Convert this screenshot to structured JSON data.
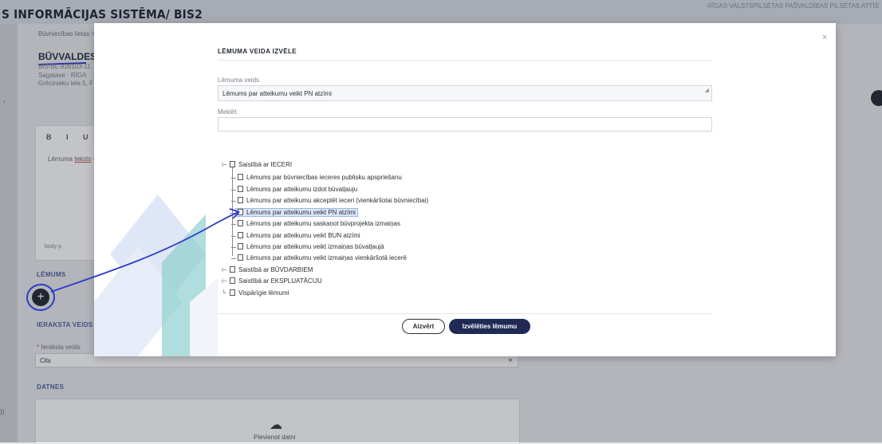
{
  "app": {
    "title": "S INFORMĀCIJAS SISTĒMA/ BIS2",
    "top_right": "RĪGAS VALSTSPILSĒTAS PAŠVALDĪBAS PILSĒTAS ATTĪS"
  },
  "background": {
    "breadcrumb": "Būvniecības lietas > B",
    "doc_title": "BŪVVALDES I",
    "doc_id": "BIS-BL-828103-11",
    "doc_status": "Sagatave · RĪGA",
    "doc_address": "Grēcinieku iela 5, F",
    "editor_toolbar": "B I U ×,",
    "editor_text_prefix": "Lēmuma ",
    "editor_text_underlined": "teksts",
    "editor_text_suffix": " -",
    "editor_footer": "body  p",
    "section_lemums": "LĒMUMS",
    "section_ieraksta_veids": "IERAKSTA VEIDS",
    "field_label": "Ieraksta veids",
    "field_value": "Cits",
    "section_datnes": "DATNES",
    "upload_label": "Pievienot datni",
    "edge_text": "))"
  },
  "modal": {
    "title": "LĒMUMA VEIDA IZVĒLE",
    "decision_type_label": "Lēmuma veids",
    "decision_type_value": "Lēmums par atteikumu veikt PN atzīmi",
    "search_label": "Meklēt",
    "search_value": "",
    "tree": [
      {
        "label": "Saistībā ar IECERI",
        "expanded": true,
        "children": [
          {
            "label": "Lēmums par būvniecības ieceres publisku apspriešanu"
          },
          {
            "label": "Lēmums par atteikumu izdot būvatļauju"
          },
          {
            "label": "Lēmums par atteikumu akceptēt ieceri (vienkāršotai būvniecībai)"
          },
          {
            "label": "Lēmums par atteikumu veikt PN atzīmi",
            "selected": true
          },
          {
            "label": "Lēmums par atteikumu saskaņot būvprojekta izmaiņas"
          },
          {
            "label": "Lēmums par atteikumu veikt BUN atzīmi"
          },
          {
            "label": "Lēmums par atteikumu veikt izmaiņas būvatļaujā"
          },
          {
            "label": "Lēmums par atteikumu veikt izmaiņas vienkāršotā iecerē"
          }
        ]
      },
      {
        "label": "Saistībā ar BŪVDARBIEM",
        "expanded": false
      },
      {
        "label": "Saistībā ar EKSPLUATĀCIJU",
        "expanded": false
      },
      {
        "label": "Vispārīgie lēmumi",
        "expanded": false
      }
    ],
    "close_button": "Aizvērt",
    "choose_button": "Izvēlēties lēmumu"
  },
  "colors": {
    "primary_button": "#1f2a55",
    "selection_bg": "#dce7f7",
    "annotation": "#2e3cc9"
  }
}
